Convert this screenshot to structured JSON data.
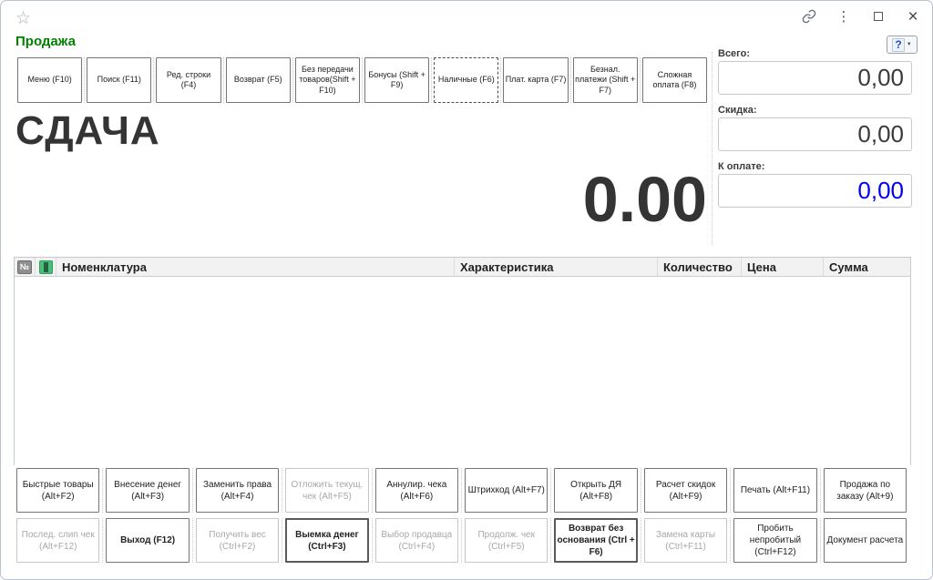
{
  "window": {
    "title": "Продажа"
  },
  "help": {
    "glyph": "?"
  },
  "toolbar": {
    "buttons": [
      {
        "label": "Меню (F10)"
      },
      {
        "label": "Поиск (F11)"
      },
      {
        "label": "Ред. строки (F4)"
      },
      {
        "label": "Возврат (F5)"
      },
      {
        "label": "Без передачи товаров(Shift + F10)"
      },
      {
        "label": "Бонусы (Shift + F9)"
      },
      {
        "label": "Наличные (F6)",
        "focused": true
      },
      {
        "label": "Плат. карта (F7)"
      },
      {
        "label": "Безнал. платежи (Shift + F7)"
      },
      {
        "label": "Сложная оплата (F8)"
      }
    ]
  },
  "display": {
    "title": "СДАЧА",
    "amount": "0.00"
  },
  "totals": {
    "total": {
      "label": "Всего:",
      "value": "0,00"
    },
    "discount": {
      "label": "Скидка:",
      "value": "0,00"
    },
    "to_pay": {
      "label": "К оплате:",
      "value": "0,00",
      "color": "#0000ee"
    }
  },
  "table": {
    "columns": {
      "num": "№",
      "nomenclature": "Номенклатура",
      "characteristic": "Характеристика",
      "quantity": "Количество",
      "price": "Цена",
      "sum": "Сумма"
    },
    "rows": []
  },
  "actions": {
    "row1": [
      {
        "label": "Быстрые товары (Alt+F2)"
      },
      {
        "label": "Внесение денег (Alt+F3)"
      },
      {
        "label": "Заменить права (Alt+F4)"
      },
      {
        "label": "Отложить текущ. чек (Alt+F5)",
        "disabled": true
      },
      {
        "label": "Аннулир. чека (Alt+F6)"
      },
      {
        "label": "Штрихкод (Alt+F7)"
      },
      {
        "label": "Открыть ДЯ (Alt+F8)"
      },
      {
        "label": "Расчет скидок (Alt+F9)"
      },
      {
        "label": "Печать (Alt+F11)"
      },
      {
        "label": "Продажа по заказу (Alt+9)"
      }
    ],
    "row2": [
      {
        "label": "Послед. слип чек (Alt+F12)",
        "disabled": true
      },
      {
        "label": "Выход (F12)",
        "bold": true
      },
      {
        "label": "Получить вес (Ctrl+F2)",
        "disabled": true
      },
      {
        "label": "Выемка денег (Ctrl+F3)",
        "bold": true
      },
      {
        "label": "Выбор продавца (Ctrl+F4)",
        "disabled": true
      },
      {
        "label": "Продолж. чек (Ctrl+F5)",
        "disabled": true
      },
      {
        "label": "Возврат без основания (Ctrl + F6)",
        "bold": true
      },
      {
        "label": "Замена карты (Ctrl+F11)",
        "disabled": true
      },
      {
        "label": "Пробить непробитый (Ctrl+F12)"
      },
      {
        "label": "Документ расчета"
      }
    ]
  },
  "colors": {
    "accent_green": "#028102",
    "value_blue": "#0000ee"
  }
}
